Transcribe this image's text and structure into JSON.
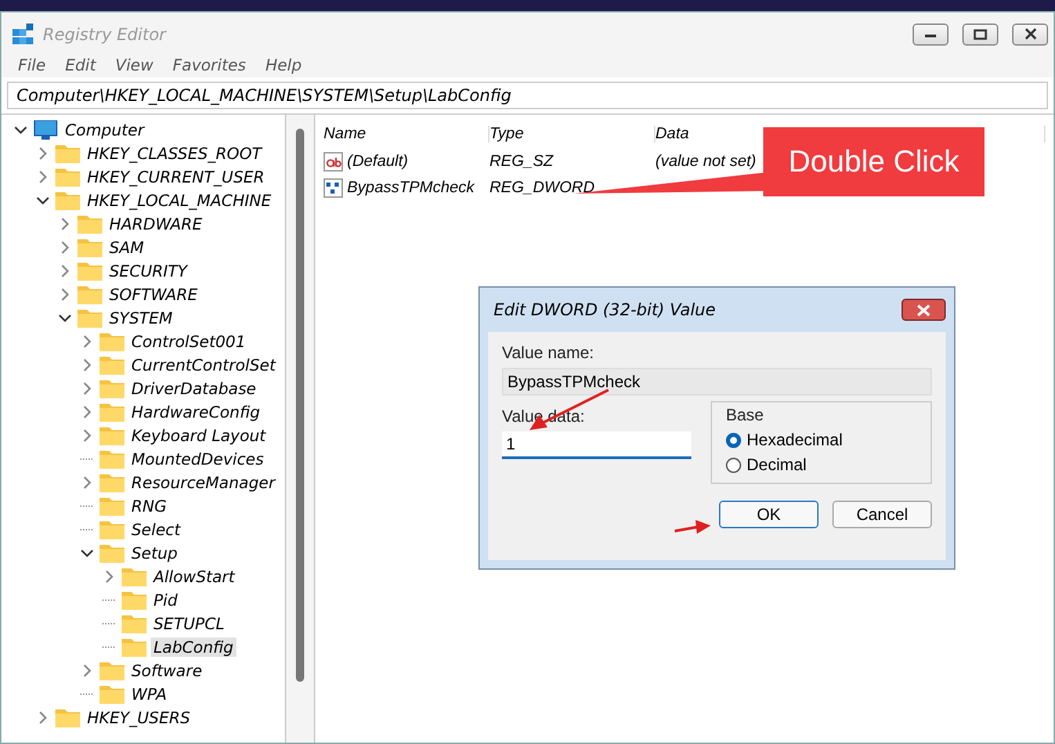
{
  "window": {
    "title": "Registry Editor"
  },
  "menu": [
    "File",
    "Edit",
    "View",
    "Favorites",
    "Help"
  ],
  "address": "Computer\\HKEY_LOCAL_MACHINE\\SYSTEM\\Setup\\LabConfig",
  "tree": [
    {
      "label": "Computer",
      "kind": "open",
      "selected": false,
      "children": [
        {
          "label": "HKEY_CLASSES_ROOT",
          "kind": "closed",
          "selected": false
        },
        {
          "label": "HKEY_CURRENT_USER",
          "kind": "closed",
          "selected": false
        },
        {
          "label": "HKEY_LOCAL_MACHINE",
          "kind": "open",
          "selected": false,
          "children": [
            {
              "label": "HARDWARE",
              "kind": "closed",
              "selected": false
            },
            {
              "label": "SAM",
              "kind": "closed",
              "selected": false
            },
            {
              "label": "SECURITY",
              "kind": "closed",
              "selected": false
            },
            {
              "label": "SOFTWARE",
              "kind": "closed",
              "selected": false
            },
            {
              "label": "SYSTEM",
              "kind": "open",
              "selected": false,
              "children": [
                {
                  "label": "ControlSet001",
                  "kind": "closed",
                  "selected": false
                },
                {
                  "label": "CurrentControlSet",
                  "kind": "closed",
                  "selected": false
                },
                {
                  "label": "DriverDatabase",
                  "kind": "closed",
                  "selected": false
                },
                {
                  "label": "HardwareConfig",
                  "kind": "closed",
                  "selected": false
                },
                {
                  "label": "Keyboard Layout",
                  "kind": "closed",
                  "selected": false
                },
                {
                  "label": "MountedDevices",
                  "kind": "leaf",
                  "selected": false
                },
                {
                  "label": "ResourceManager",
                  "kind": "closed",
                  "selected": false
                },
                {
                  "label": "RNG",
                  "kind": "leaf",
                  "selected": false
                },
                {
                  "label": "Select",
                  "kind": "leaf",
                  "selected": false
                },
                {
                  "label": "Setup",
                  "kind": "open",
                  "selected": false,
                  "children": [
                    {
                      "label": "AllowStart",
                      "kind": "closed",
                      "selected": false
                    },
                    {
                      "label": "Pid",
                      "kind": "leaf",
                      "selected": false
                    },
                    {
                      "label": "SETUPCL",
                      "kind": "leaf",
                      "selected": false
                    },
                    {
                      "label": "LabConfig",
                      "kind": "leaf",
                      "selected": true
                    }
                  ]
                },
                {
                  "label": "Software",
                  "kind": "closed",
                  "selected": false
                },
                {
                  "label": "WPA",
                  "kind": "leaf",
                  "selected": false
                }
              ]
            }
          ]
        },
        {
          "label": "HKEY_USERS",
          "kind": "closed",
          "selected": false
        }
      ]
    }
  ],
  "columns": [
    "Name",
    "Type",
    "Data"
  ],
  "values": [
    {
      "name": "(Default)",
      "kind": "string",
      "type": "REG_SZ",
      "data": "(value not set)"
    },
    {
      "name": "BypassTPMcheck",
      "kind": "binary",
      "type": "REG_DWORD"
    }
  ],
  "callout": "Double Click",
  "dialog": {
    "title": "Edit DWORD (32-bit) Value",
    "name_label": "Value name:",
    "name_value": "BypassTPMcheck",
    "data_label": "Value data:",
    "data_value": "1",
    "base_label": "Base",
    "bases": [
      {
        "label": "Hexadecimal",
        "selected": true
      },
      {
        "label": "Decimal",
        "selected": false
      }
    ],
    "buttons": [
      "OK",
      "Cancel"
    ]
  }
}
